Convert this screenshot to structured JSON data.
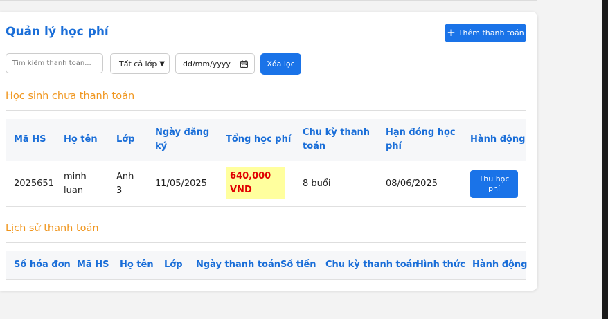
{
  "header": {
    "title": "Quản lý học phí",
    "add_button": "Thêm thanh toán"
  },
  "filters": {
    "search_placeholder": "Tìm kiếm thanh toán...",
    "class_selected": "Tất cả lớp",
    "date_placeholder": "dd/mm/yyyy",
    "clear_button": "Xóa lọc"
  },
  "unpaid": {
    "title": "Học sinh chưa thanh toán",
    "headers": {
      "id": "Mã HS",
      "name": "Họ tên",
      "class": "Lớp",
      "reg_date_1": "Ngày đăng",
      "reg_date_2": "ký",
      "total_fee": "Tổng học phí",
      "cycle_1": "Chu kỳ thanh",
      "cycle_2": "toán",
      "due_1": "Hạn đóng học",
      "due_2": "phí",
      "action": "Hành động"
    },
    "rows": [
      {
        "id": "2025651",
        "name_1": "minh",
        "name_2": "luan",
        "class_1": "Anh",
        "class_2": "3",
        "reg_date": "11/05/2025",
        "fee_1": "640,000",
        "fee_2": "VND",
        "cycle": "8 buổi",
        "due": "08/06/2025",
        "action_1": "Thu học",
        "action_2": "phí"
      }
    ]
  },
  "history": {
    "title": "Lịch sử thanh toán",
    "headers": [
      "Số hóa đơn",
      "Mã HS",
      "Họ tên",
      "Lớp",
      "Ngày thanh toán",
      "Số tiền",
      "Chu kỳ thanh toán",
      "Hình thức",
      "Hành động"
    ]
  },
  "colors": {
    "primary": "#1a73e8",
    "heading": "#1a6ed8",
    "section": "#f0961e",
    "fee_text": "#e00000",
    "fee_bg": "#ffff9e"
  },
  "icons": {
    "add": "plus-icon",
    "dropdown": "chevron-down-icon",
    "date": "calendar-icon"
  }
}
